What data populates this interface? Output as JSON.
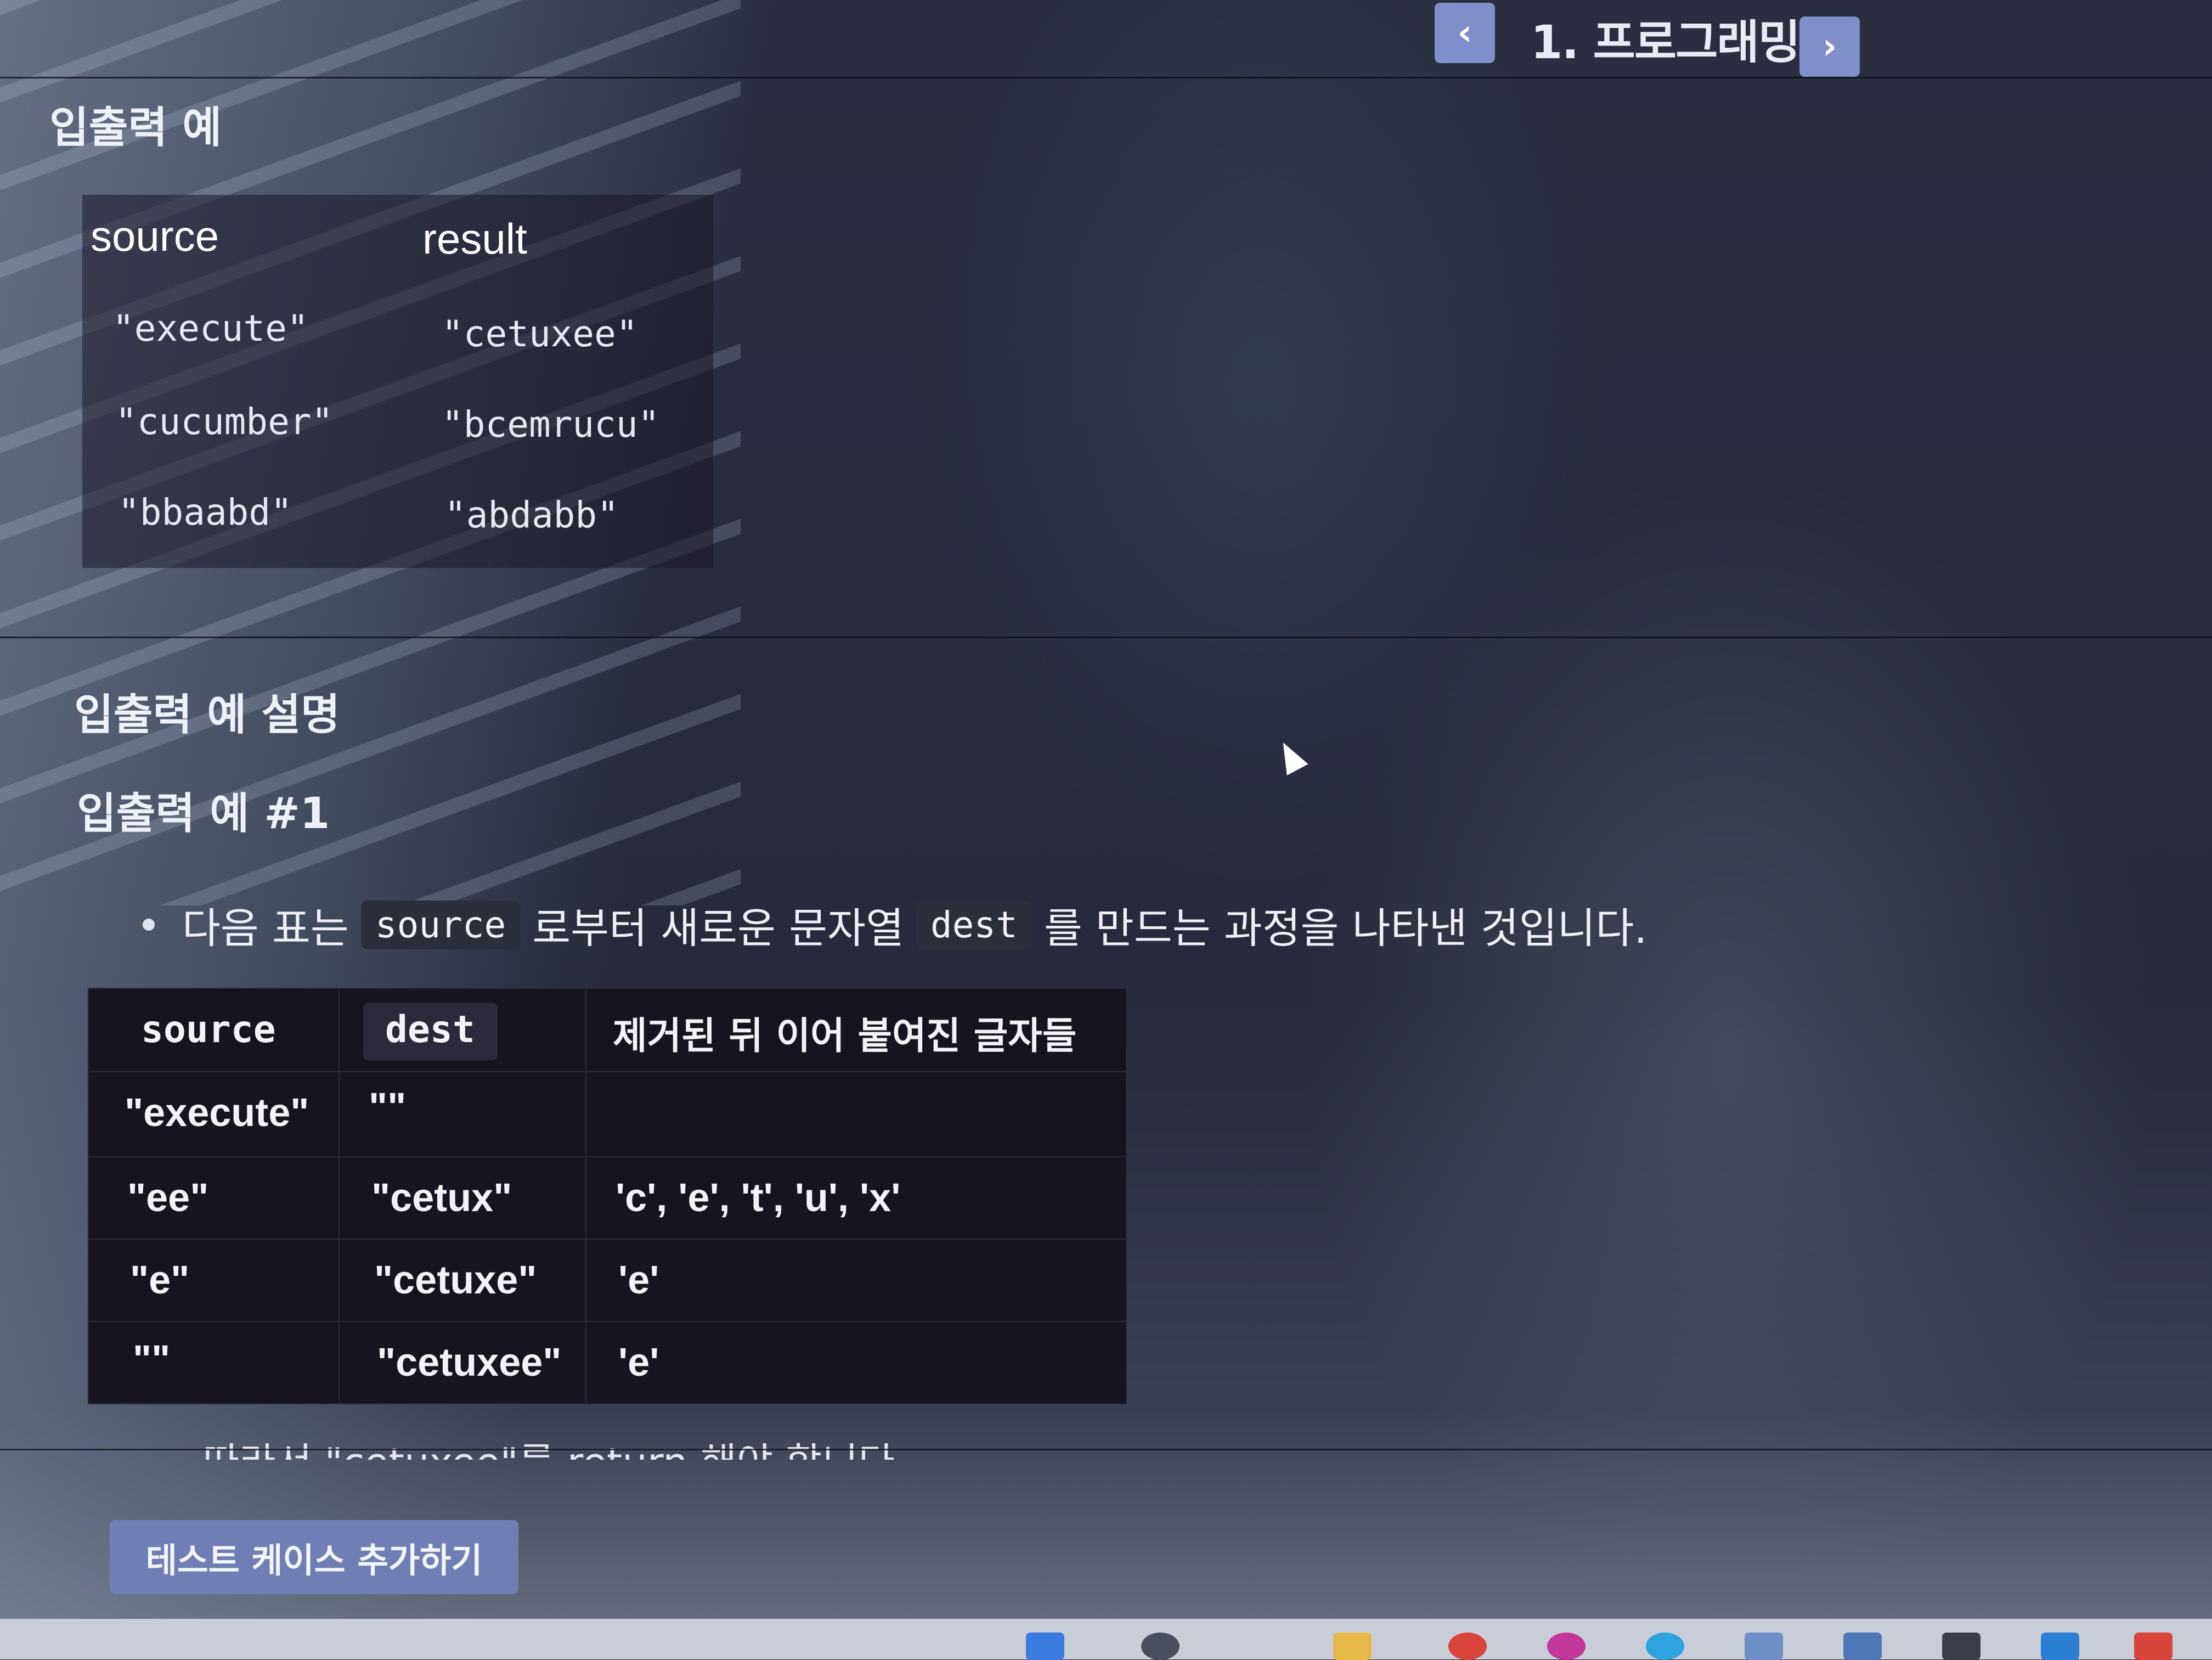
{
  "nav": {
    "title": "1. 프로그래밍",
    "prev_icon": "chevron-left-icon",
    "next_icon": "chevron-right-icon"
  },
  "io_example": {
    "heading": "입출력 예",
    "columns": [
      "source",
      "result"
    ],
    "rows": [
      [
        "\"execute\"",
        "\"cetuxee\""
      ],
      [
        "\"cucumber\"",
        "\"bcemrucu\""
      ],
      [
        "\"bbaabd\"",
        "\"abdabb\""
      ]
    ]
  },
  "explanation": {
    "heading": "입출력 예 설명",
    "subheading": "입출력 예 #1",
    "bullet_parts": [
      "다음 표는",
      "source",
      "로부터 새로운 문자열",
      "dest",
      "를 만드는 과정을 나타낸 것입니다."
    ],
    "table_columns": [
      "source",
      "dest",
      "제거된 뒤 이어 붙여진 글자들"
    ],
    "table_rows": [
      [
        "\"execute\"",
        "\"\"",
        ""
      ],
      [
        "\"ee\"",
        "\"cetux\"",
        "'c', 'e', 't', 'u', 'x'"
      ],
      [
        "\"e\"",
        "\"cetuxe\"",
        "'e'"
      ],
      [
        "\"\"",
        "\"cetuxee\"",
        "'e'"
      ]
    ],
    "cut_off_text": "따라서 \"cetuxee\"를 return 해야 합니다."
  },
  "footer": {
    "add_test_case_label": "테스트 케이스 추가하기"
  }
}
